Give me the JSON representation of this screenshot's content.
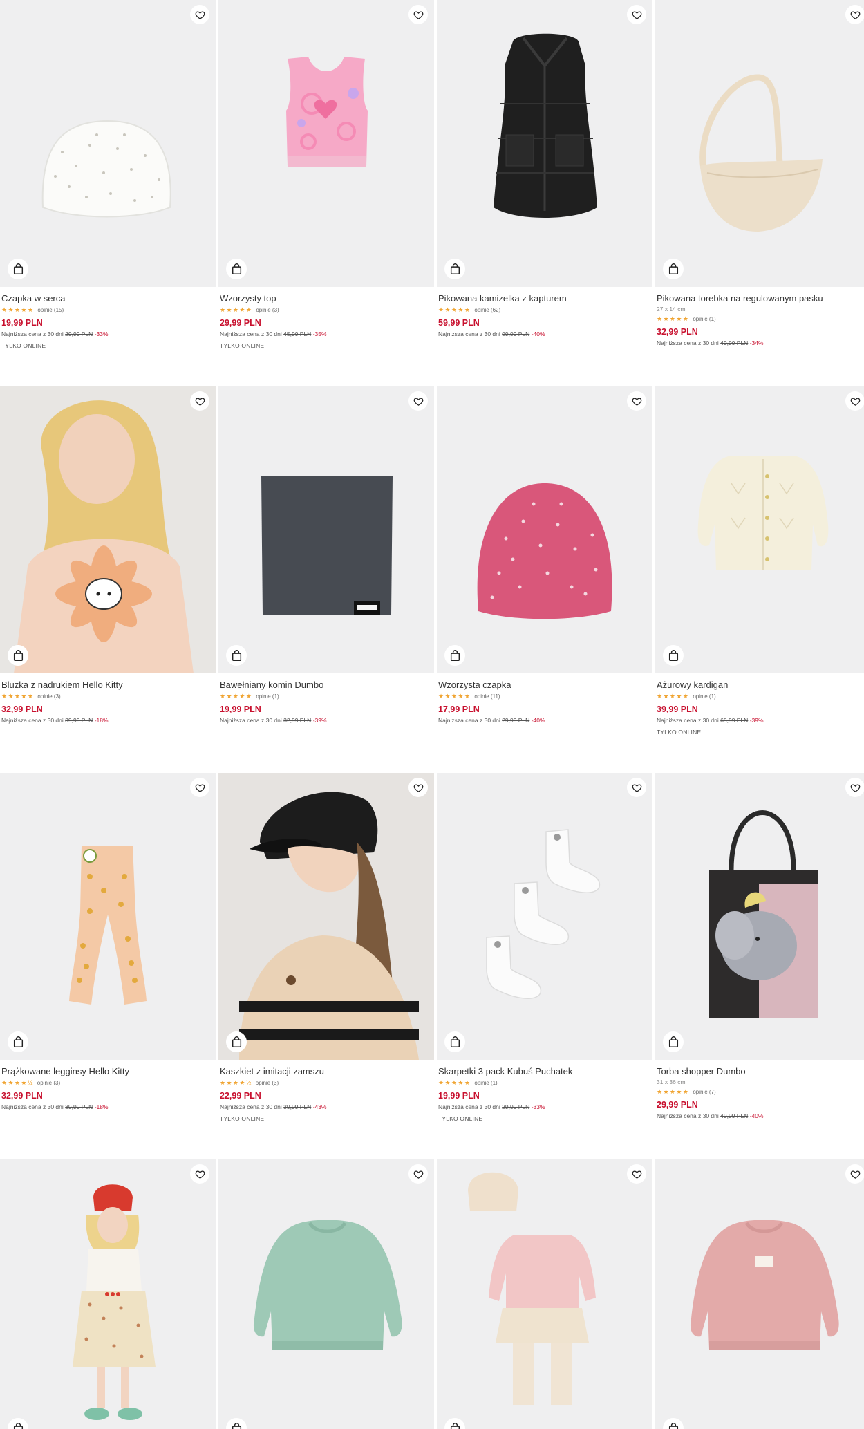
{
  "products": [
    {
      "name": "Czapka w serca",
      "dims": "",
      "stars": "★★★★★",
      "reviews": "opinie (15)",
      "price": "19,99 PLN",
      "lowest_label": "Najniższa cena z 30 dni",
      "old_price": "29,99 PLN",
      "discount": "-33%",
      "badge": "TYLKO ONLINE",
      "icon": "white-beanie"
    },
    {
      "name": "Wzorzysty top",
      "dims": "",
      "stars": "★★★★★",
      "reviews": "opinie (3)",
      "price": "29,99 PLN",
      "lowest_label": "Najniższa cena z 30 dni",
      "old_price": "45,99 PLN",
      "discount": "-35%",
      "badge": "TYLKO ONLINE",
      "icon": "pink-top"
    },
    {
      "name": "Pikowana kamizelka z kapturem",
      "dims": "",
      "stars": "★★★★★",
      "reviews": "opinie (62)",
      "price": "59,99 PLN",
      "lowest_label": "Najniższa cena z 30 dni",
      "old_price": "99,99 PLN",
      "discount": "-40%",
      "badge": "",
      "icon": "black-vest"
    },
    {
      "name": "Pikowana torebka na regulowanym pasku",
      "dims": "27 x 14 cm",
      "stars": "★★★★★",
      "reviews": "opinie (1)",
      "price": "32,99 PLN",
      "lowest_label": "Najniższa cena z 30 dni",
      "old_price": "49,99 PLN",
      "discount": "-34%",
      "badge": "",
      "icon": "beige-bag"
    },
    {
      "name": "Bluzka z nadrukiem Hello Kitty",
      "dims": "",
      "stars": "★★★★★",
      "reviews": "opinie (3)",
      "price": "32,99 PLN",
      "lowest_label": "Najniższa cena z 30 dni",
      "old_price": "39,99 PLN",
      "discount": "-18%",
      "badge": "",
      "icon": "girl-hello-kitty"
    },
    {
      "name": "Bawełniany komin Dumbo",
      "dims": "",
      "stars": "★★★★★",
      "reviews": "opinie (1)",
      "price": "19,99 PLN",
      "lowest_label": "Najniższa cena z 30 dni",
      "old_price": "32,99 PLN",
      "discount": "-39%",
      "badge": "",
      "icon": "grey-snood"
    },
    {
      "name": "Wzorzysta czapka",
      "dims": "",
      "stars": "★★★★★",
      "reviews": "opinie (11)",
      "price": "17,99 PLN",
      "lowest_label": "Najniższa cena z 30 dni",
      "old_price": "29,99 PLN",
      "discount": "-40%",
      "badge": "",
      "icon": "pink-beanie"
    },
    {
      "name": "Ażurowy kardigan",
      "dims": "",
      "stars": "★★★★★",
      "reviews": "opinie (1)",
      "price": "39,99 PLN",
      "lowest_label": "Najniższa cena z 30 dni",
      "old_price": "65,99 PLN",
      "discount": "-39%",
      "badge": "TYLKO ONLINE",
      "icon": "cream-cardigan"
    },
    {
      "name": "Prążkowane legginsy Hello Kitty",
      "dims": "",
      "stars": "★★★★½",
      "reviews": "opinie (3)",
      "price": "32,99 PLN",
      "lowest_label": "Najniższa cena z 30 dni",
      "old_price": "39,99 PLN",
      "discount": "-18%",
      "badge": "",
      "icon": "peach-leggings"
    },
    {
      "name": "Kaszkiet z imitacji zamszu",
      "dims": "",
      "stars": "★★★★½",
      "reviews": "opinie (3)",
      "price": "22,99 PLN",
      "lowest_label": "Najniższa cena z 30 dni",
      "old_price": "39,99 PLN",
      "discount": "-43%",
      "badge": "TYLKO ONLINE",
      "icon": "girl-cap"
    },
    {
      "name": "Skarpetki 3 pack Kubuś Puchatek",
      "dims": "",
      "stars": "★★★★★",
      "reviews": "opinie (1)",
      "price": "19,99 PLN",
      "lowest_label": "Najniższa cena z 30 dni",
      "old_price": "29,99 PLN",
      "discount": "-33%",
      "badge": "TYLKO ONLINE",
      "icon": "white-socks"
    },
    {
      "name": "Torba shopper Dumbo",
      "dims": "31 x 36 cm",
      "stars": "★★★★★",
      "reviews": "opinie (7)",
      "price": "29,99 PLN",
      "lowest_label": "Najniższa cena z 30 dni",
      "old_price": "49,99 PLN",
      "discount": "-40%",
      "badge": "",
      "icon": "dumbo-tote"
    },
    {
      "name": "",
      "dims": "",
      "stars": "",
      "reviews": "",
      "price": "",
      "lowest_label": "",
      "old_price": "",
      "discount": "",
      "badge": "",
      "icon": "girl-red-hat"
    },
    {
      "name": "",
      "dims": "",
      "stars": "",
      "reviews": "",
      "price": "",
      "lowest_label": "",
      "old_price": "",
      "discount": "",
      "badge": "",
      "icon": "mint-sweatshirt"
    },
    {
      "name": "",
      "dims": "",
      "stars": "",
      "reviews": "",
      "price": "",
      "lowest_label": "",
      "old_price": "",
      "discount": "",
      "badge": "",
      "icon": "pink-set-turban"
    },
    {
      "name": "",
      "dims": "",
      "stars": "",
      "reviews": "",
      "price": "",
      "lowest_label": "",
      "old_price": "",
      "discount": "",
      "badge": "",
      "icon": "pink-sweatshirt"
    }
  ],
  "icons": {
    "favorite": "heart-icon",
    "cart": "shopping-bag-icon"
  },
  "colors": {
    "price": "#c8102e",
    "stars": "#f0a533",
    "tile_bg": "#efeff0"
  }
}
